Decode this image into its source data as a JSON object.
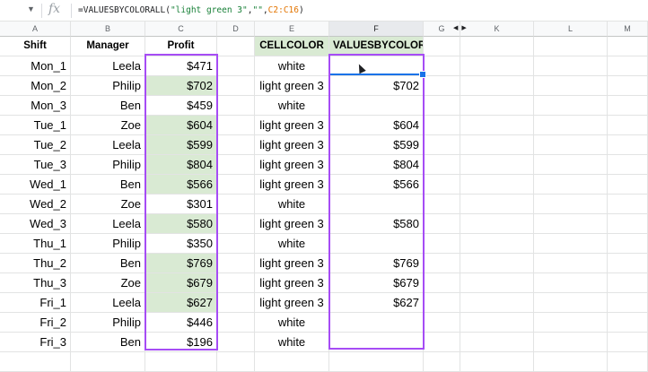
{
  "formula_bar": {
    "fx_label": "fx",
    "prefix": "=VALUESBYCOLORALL(",
    "arg1": "\"light green 3\"",
    "comma1": ",",
    "arg2": "\"\"",
    "comma2": ",",
    "arg3": "C2:C16",
    "suffix": ")"
  },
  "columns": [
    "A",
    "B",
    "C",
    "D",
    "E",
    "F",
    "G",
    "K",
    "L",
    "M"
  ],
  "headers": {
    "shift": "Shift",
    "manager": "Manager",
    "profit": "Profit",
    "cellcolor": "CELLCOLOR",
    "values": "VALUESBYCOLORALL"
  },
  "rows": [
    {
      "shift": "Mon_1",
      "manager": "Leela",
      "profit": "$471",
      "color": "white",
      "value": ""
    },
    {
      "shift": "Mon_2",
      "manager": "Philip",
      "profit": "$702",
      "color": "light green 3",
      "value": "$702"
    },
    {
      "shift": "Mon_3",
      "manager": "Ben",
      "profit": "$459",
      "color": "white",
      "value": ""
    },
    {
      "shift": "Tue_1",
      "manager": "Zoe",
      "profit": "$604",
      "color": "light green 3",
      "value": "$604"
    },
    {
      "shift": "Tue_2",
      "manager": "Leela",
      "profit": "$599",
      "color": "light green 3",
      "value": "$599"
    },
    {
      "shift": "Tue_3",
      "manager": "Philip",
      "profit": "$804",
      "color": "light green 3",
      "value": "$804"
    },
    {
      "shift": "Wed_1",
      "manager": "Ben",
      "profit": "$566",
      "color": "light green 3",
      "value": "$566"
    },
    {
      "shift": "Wed_2",
      "manager": "Zoe",
      "profit": "$301",
      "color": "white",
      "value": ""
    },
    {
      "shift": "Wed_3",
      "manager": "Leela",
      "profit": "$580",
      "color": "light green 3",
      "value": "$580"
    },
    {
      "shift": "Thu_1",
      "manager": "Philip",
      "profit": "$350",
      "color": "white",
      "value": ""
    },
    {
      "shift": "Thu_2",
      "manager": "Ben",
      "profit": "$769",
      "color": "light green 3",
      "value": "$769"
    },
    {
      "shift": "Thu_3",
      "manager": "Zoe",
      "profit": "$679",
      "color": "light green 3",
      "value": "$679"
    },
    {
      "shift": "Fri_1",
      "manager": "Leela",
      "profit": "$627",
      "color": "light green 3",
      "value": "$627"
    },
    {
      "shift": "Fri_2",
      "manager": "Philip",
      "profit": "$446",
      "color": "white",
      "value": ""
    },
    {
      "shift": "Fri_3",
      "manager": "Ben",
      "profit": "$196",
      "color": "white",
      "value": ""
    }
  ],
  "colors": {
    "green_fill": "#d9ead3",
    "highlight_border": "#a64cf5",
    "selection": "#1a73e8"
  }
}
